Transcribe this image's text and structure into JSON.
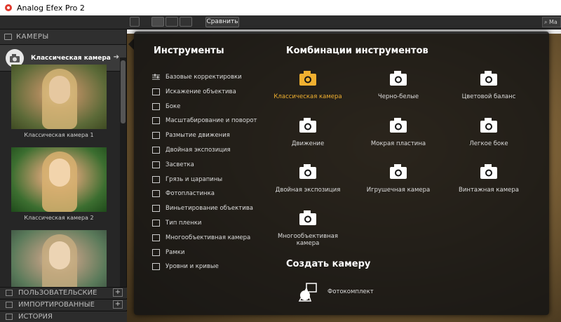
{
  "app": {
    "title": "Analog Efex Pro 2"
  },
  "toolbar": {
    "compare_label": "Сравнить",
    "search_placeholder": "Ma"
  },
  "sidebar": {
    "header": "КАМЕРЫ",
    "selected_preset": "Классическая камера",
    "thumbnails": [
      {
        "caption": "Классическая камера 1"
      },
      {
        "caption": "Классическая камера 2"
      },
      {
        "caption": ""
      }
    ],
    "sections": [
      {
        "label": "ПОЛЬЗОВАТЕЛЬСКИЕ"
      },
      {
        "label": "ИМПОРТИРОВАННЫЕ"
      },
      {
        "label": "ИСТОРИЯ"
      }
    ]
  },
  "popup": {
    "tools_title": "Инструменты",
    "tools": [
      {
        "label": "Базовые корректировки",
        "icon": "sliders-icon"
      },
      {
        "label": "Искажение объектива",
        "icon": "lens-distortion-icon"
      },
      {
        "label": "Боке",
        "icon": "bokeh-icon"
      },
      {
        "label": "Масштабирование и поворот",
        "icon": "zoom-rotate-icon"
      },
      {
        "label": "Размытие движения",
        "icon": "motion-blur-icon"
      },
      {
        "label": "Двойная экспозиция",
        "icon": "double-exposure-icon"
      },
      {
        "label": "Засветка",
        "icon": "light-leak-icon"
      },
      {
        "label": "Грязь и царапины",
        "icon": "dirt-scratches-icon"
      },
      {
        "label": "Фотопластинка",
        "icon": "photo-plate-icon"
      },
      {
        "label": "Виньетирование объектива",
        "icon": "vignette-icon"
      },
      {
        "label": "Тип пленки",
        "icon": "film-type-icon"
      },
      {
        "label": "Многообъективная камера",
        "icon": "multi-lens-icon"
      },
      {
        "label": "Рамки",
        "icon": "frames-icon"
      },
      {
        "label": "Уровни и кривые",
        "icon": "levels-curves-icon"
      }
    ],
    "combos_title": "Комбинации инструментов",
    "combos": [
      {
        "label": "Классическая камера",
        "icon": "classic-camera-icon",
        "active": true
      },
      {
        "label": "Черно-белые",
        "icon": "bw-camera-icon"
      },
      {
        "label": "Цветовой баланс",
        "icon": "color-balance-camera-icon"
      },
      {
        "label": "Движение",
        "icon": "movie-camera-icon"
      },
      {
        "label": "Мокрая пластина",
        "icon": "wet-plate-camera-icon"
      },
      {
        "label": "Легкое боке",
        "icon": "subtle-bokeh-camera-icon"
      },
      {
        "label": "Двойная экспозиция",
        "icon": "tlr-camera-icon"
      },
      {
        "label": "Игрушечная камера",
        "icon": "toy-camera-icon"
      },
      {
        "label": "Винтажная камера",
        "icon": "vintage-camera-icon"
      },
      {
        "label": "Многообъективная камера",
        "icon": "multi-lens-camera-icon"
      }
    ],
    "create_title": "Создать камеру",
    "create_item": {
      "label": "Фотокомплект",
      "icon": "camera-kit-icon"
    }
  },
  "colors": {
    "accent": "#f0b030",
    "popup_bg": "#141414"
  }
}
